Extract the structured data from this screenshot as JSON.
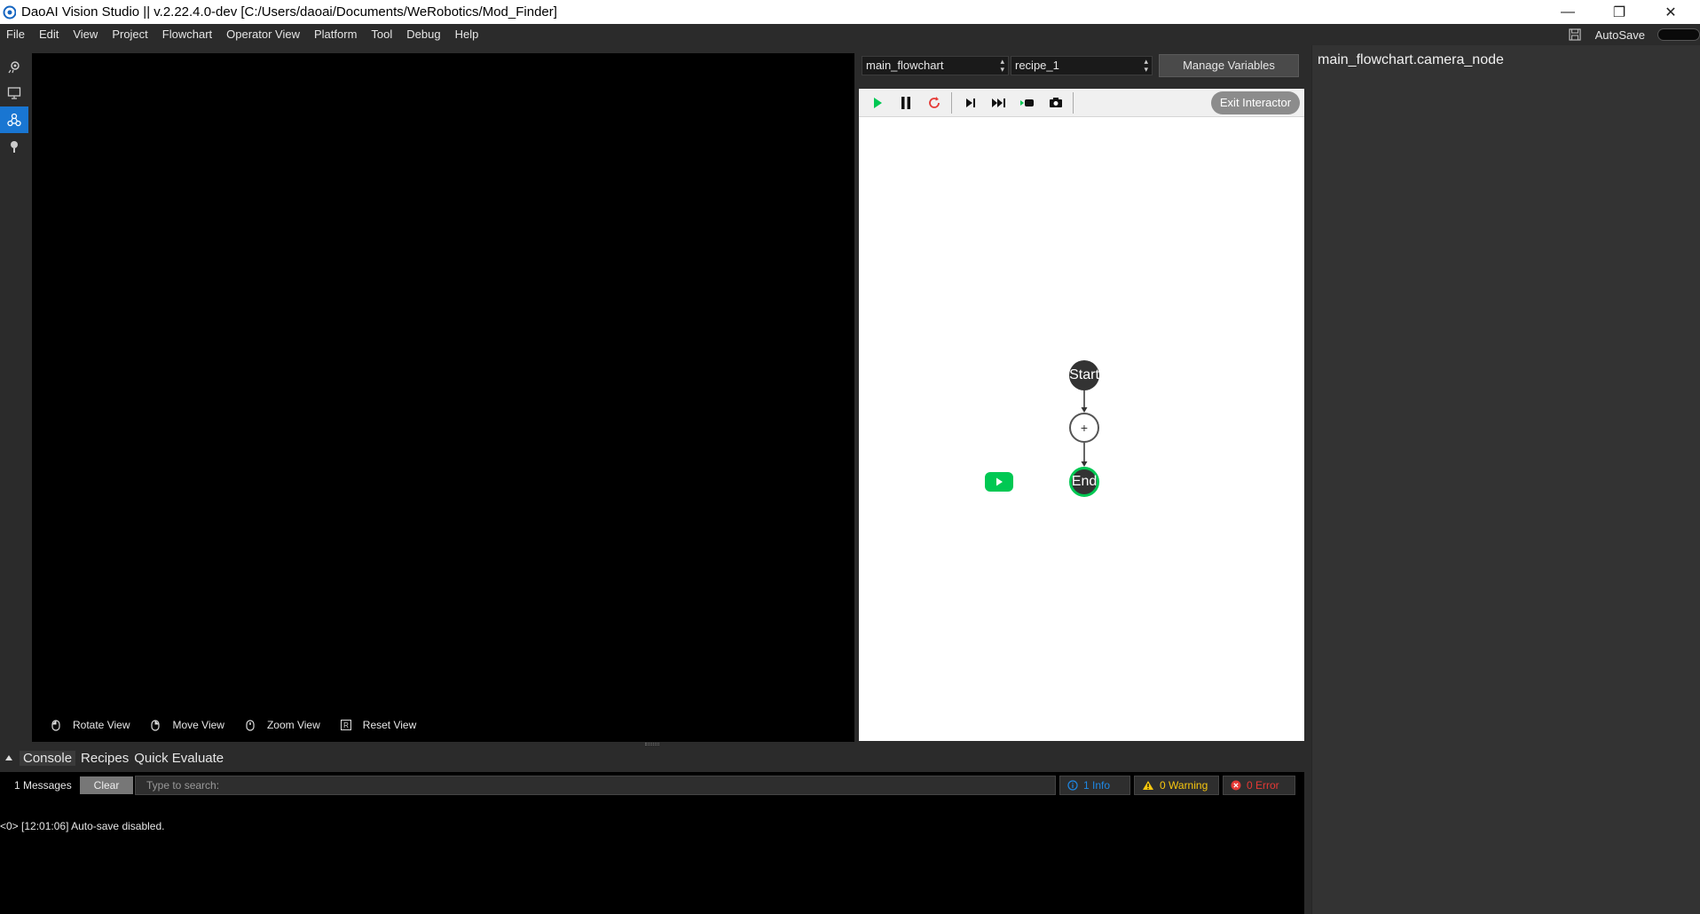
{
  "window": {
    "title": "DaoAI Vision Studio || v.2.22.4.0-dev   [C:/Users/daoai/Documents/WeRobotics/Mod_Finder]",
    "minimize": "—",
    "restore": "❐",
    "close": "✕"
  },
  "menu": {
    "items": [
      "File",
      "Edit",
      "View",
      "Project",
      "Flowchart",
      "Operator View",
      "Platform",
      "Tool",
      "Debug",
      "Help"
    ],
    "autosave_label": "AutoSave",
    "autosave_on": false
  },
  "leftbar": {
    "items": [
      {
        "icon": "camera-icon"
      },
      {
        "icon": "monitor-icon"
      },
      {
        "icon": "flowchart-icon",
        "active": true
      },
      {
        "icon": "bulb-icon"
      }
    ],
    "active_color": "#1976d2"
  },
  "viewport": {
    "hints": [
      {
        "icon": "mouse-left-icon",
        "label": "Rotate View"
      },
      {
        "icon": "mouse-right-icon",
        "label": "Move View"
      },
      {
        "icon": "mouse-wheel-icon",
        "label": "Zoom View"
      },
      {
        "icon": "key-r-icon",
        "label": "Reset View"
      }
    ]
  },
  "flowchart": {
    "flowchart_select": "main_flowchart",
    "recipe_select": "recipe_1",
    "manage_variables_label": "Manage Variables",
    "exit_interactor_label": "Exit Interactor",
    "toolbar": [
      "play-icon",
      "pause-icon",
      "reset-icon",
      "step-icon",
      "fast-forward-icon",
      "run-to-icon",
      "capture-icon"
    ],
    "nodes": {
      "start_label": "Start",
      "plus_label": "+",
      "end_label": "End"
    },
    "accent_green": "#00c853"
  },
  "properties": {
    "title": "main_flowchart.camera_node"
  },
  "console": {
    "tabs": [
      "Console",
      "Recipes",
      "Quick Evaluate"
    ],
    "message_count": "1 Messages",
    "clear_label": "Clear",
    "search_placeholder": "Type to search:",
    "info_label": "1 Info",
    "warning_label": "0 Warning",
    "error_label": "0 Error",
    "info_color": "#1e88e5",
    "warning_color": "#f9c80e",
    "error_color": "#e53935",
    "log_line": "<0> [12:01:06] Auto-save disabled."
  }
}
